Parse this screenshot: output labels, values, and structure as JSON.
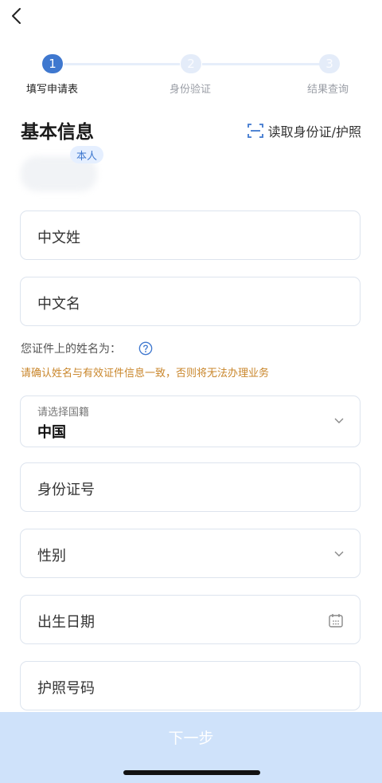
{
  "nav": {
    "back_icon": "chevron-left-icon"
  },
  "steps": [
    {
      "number": "1",
      "label": "填写申请表",
      "active": true
    },
    {
      "number": "2",
      "label": "身份验证",
      "active": false
    },
    {
      "number": "3",
      "label": "结果查询",
      "active": false
    }
  ],
  "section": {
    "title": "基本信息",
    "read_id_label": "读取身份证/护照",
    "read_id_icon": "scan-icon"
  },
  "profile": {
    "badge": "本人"
  },
  "fields": {
    "surname": {
      "placeholder": "中文姓"
    },
    "given_name": {
      "placeholder": "中文名"
    },
    "nationality": {
      "label": "请选择国籍",
      "value": "中国"
    },
    "id_number": {
      "placeholder": "身份证号"
    },
    "gender": {
      "placeholder": "性别"
    },
    "birth_date": {
      "placeholder": "出生日期"
    },
    "passport_number": {
      "placeholder": "护照号码"
    }
  },
  "name_hint": {
    "text": "您证件上的姓名为：",
    "help_icon": "question-circle-icon",
    "warning": "请确认姓名与有效证件信息一致，否则将无法办理业务"
  },
  "footer": {
    "next_label": "下一步"
  },
  "colors": {
    "accent": "#3f78cf",
    "warning": "#c9862b",
    "button_bg": "#cfe2fa",
    "border": "#dde4ee"
  }
}
